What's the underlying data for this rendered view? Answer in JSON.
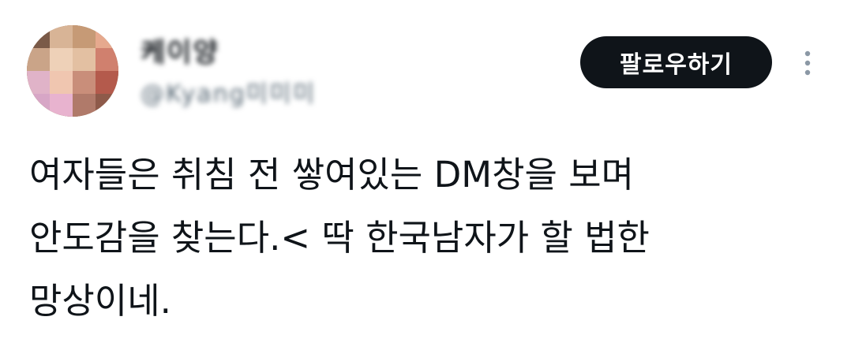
{
  "user": {
    "display_name": "케이양",
    "handle": "@Kyang미미미"
  },
  "actions": {
    "follow_label": "팔로우하기",
    "more_icon": "more-vertical-icon"
  },
  "tweet": {
    "lines": [
      "여자들은 취침 전 쌓여있는 DM창을 보며",
      "안도감을 찾는다.< 딱 한국남자가 할 법한",
      "망상이네."
    ]
  },
  "colors": {
    "text": "#0f1419",
    "secondary": "#536471",
    "button_bg": "#0f1419",
    "button_text": "#ffffff",
    "background": "#ffffff"
  }
}
